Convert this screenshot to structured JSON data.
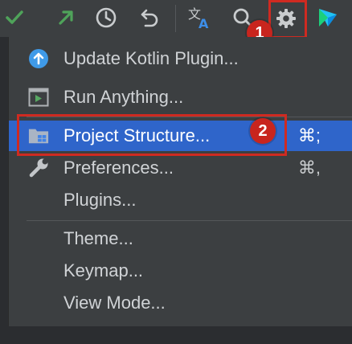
{
  "toolbar": {
    "buttons": [
      {
        "icon": "check-icon",
        "color": "#4fa35a"
      },
      {
        "icon": "arrow-up-right-icon",
        "color": "#4fa35a"
      },
      {
        "icon": "history-icon",
        "color": "#c9ccce"
      },
      {
        "icon": "undo-icon",
        "color": "#c9ccce"
      },
      {
        "icon": "translate-icon",
        "color": "#c9ccce"
      },
      {
        "icon": "search-icon",
        "color": "#c9ccce"
      },
      {
        "icon": "gear-icon",
        "color": "#c9ccce"
      },
      {
        "icon": "jetbrains-logo-icon",
        "color": "#21c3f3"
      }
    ]
  },
  "annotations": {
    "badge1": "1",
    "badge2": "2"
  },
  "menu": {
    "items": [
      {
        "label": "Update Kotlin Plugin...",
        "shortcut": "",
        "icon": "upload-circle-icon"
      },
      {
        "label": "Run Anything...",
        "shortcut": "",
        "icon": "run-anything-icon"
      },
      {
        "label": "Project Structure...",
        "shortcut": "⌘;",
        "icon": "project-structure-icon",
        "selected": true
      },
      {
        "label": "Preferences...",
        "shortcut": "⌘,",
        "icon": "wrench-icon"
      },
      {
        "label": "Plugins...",
        "shortcut": ""
      },
      {
        "label": "Theme...",
        "shortcut": ""
      },
      {
        "label": "Keymap...",
        "shortcut": ""
      },
      {
        "label": "View Mode...",
        "shortcut": ""
      }
    ]
  },
  "colors": {
    "selection": "#2f65ca",
    "annotation_red": "#cf2a21",
    "menu_bg": "#3c3f41",
    "text": "#d0d3d6"
  }
}
